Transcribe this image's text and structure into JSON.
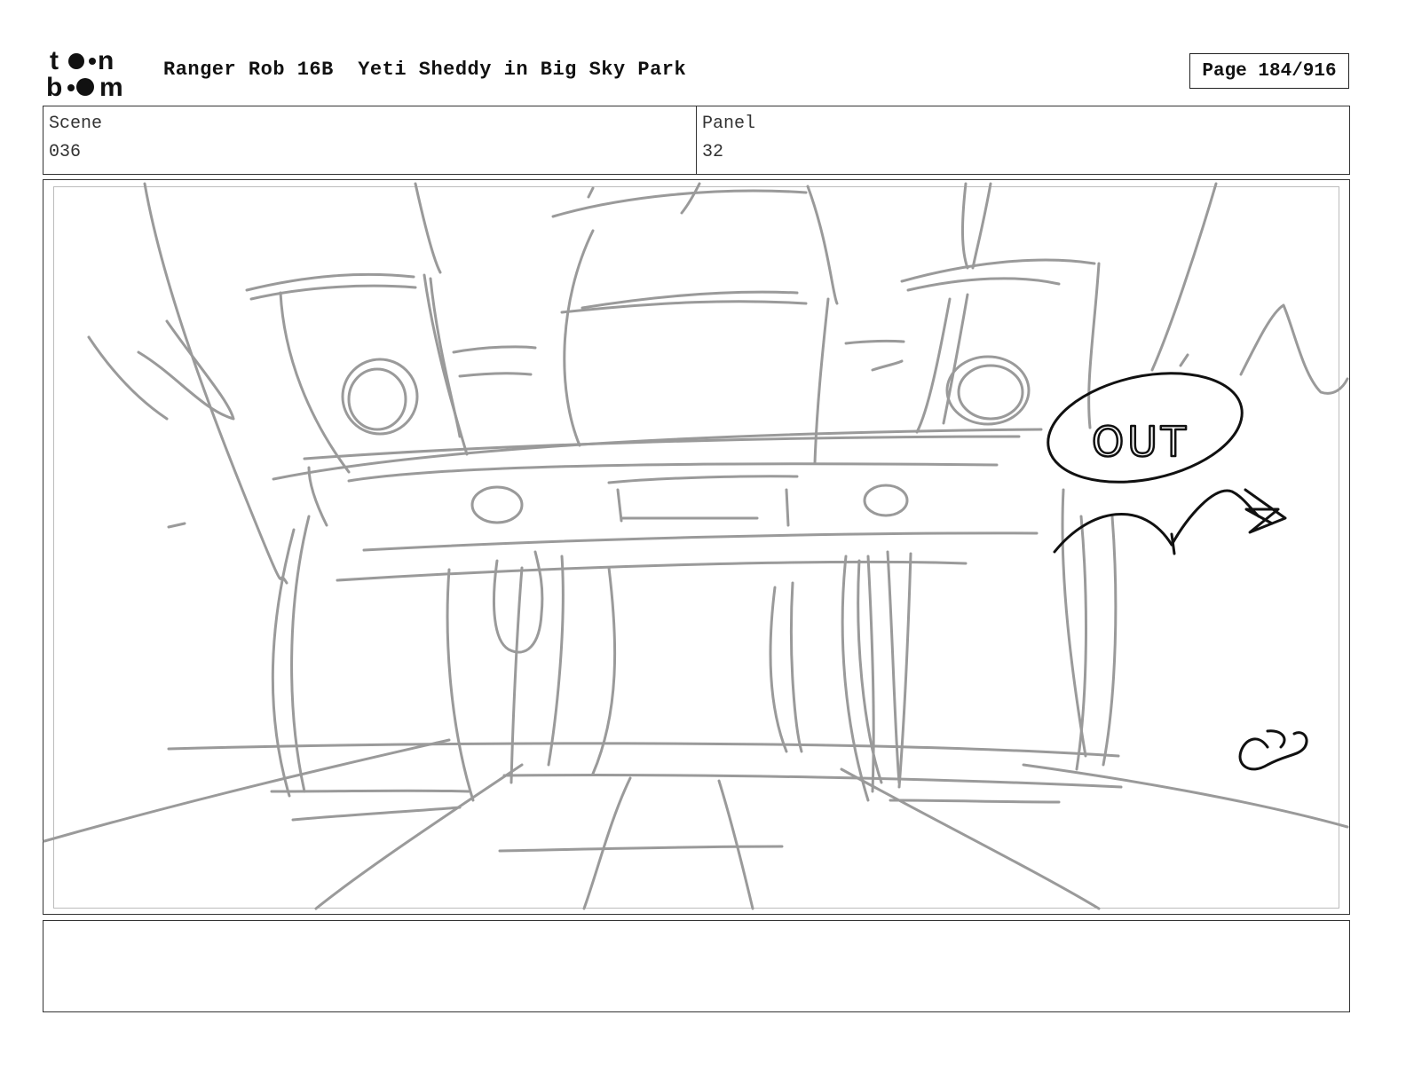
{
  "header": {
    "logo_text": "toon boom",
    "title": "Ranger Rob 16B  Yeti Sheddy in Big Sky Park",
    "page": "Page 184/916"
  },
  "info": {
    "scene_label": "Scene",
    "scene_value": "036",
    "panel_label": "Panel",
    "panel_value": "32"
  },
  "sketch": {
    "speech_text": "OUT",
    "line_color": "#9a9a9a",
    "ink_color": "#111111"
  },
  "notes": {
    "text": ""
  }
}
